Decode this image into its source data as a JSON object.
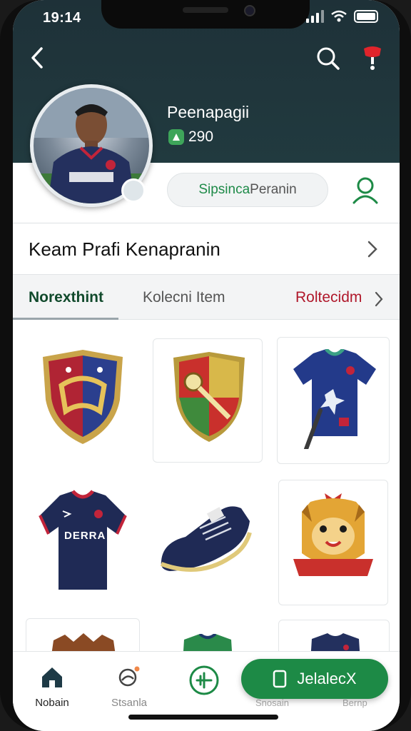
{
  "status_bar": {
    "time": "19:14"
  },
  "profile": {
    "name": "Peenapagii",
    "points": "290",
    "follow_button": {
      "green_part": "Sipsinca",
      "gray_part": " Peranin"
    }
  },
  "team_row": {
    "label": "Keam Prafi Kenapranin"
  },
  "tabs": [
    {
      "label": "Norexthint",
      "active": true
    },
    {
      "label": "Kolecni Item",
      "active": false
    },
    {
      "label": "Roltecidm",
      "active": false
    }
  ],
  "items": [
    {
      "name": "crest-harp",
      "icon": "crest-icon"
    },
    {
      "name": "crest-key",
      "icon": "crest-icon"
    },
    {
      "name": "away-jersey-bat",
      "icon": "jersey-icon"
    },
    {
      "name": "home-jersey",
      "icon": "jersey-icon",
      "text": "DERRA"
    },
    {
      "name": "navy-boot",
      "icon": "boot-icon"
    },
    {
      "name": "tiger-crest",
      "icon": "crest-icon"
    },
    {
      "name": "brown-item",
      "icon": "item-icon"
    },
    {
      "name": "green-jersey",
      "icon": "jersey-icon"
    },
    {
      "name": "navy-jersey",
      "icon": "jersey-icon"
    }
  ],
  "bottom_nav": {
    "home_label": "Nobain",
    "search_label": "Stsanla",
    "ghost_label_1": "Snosain",
    "ghost_label_2": "Bernp",
    "cta_label": "JelalecX"
  },
  "colors": {
    "header": "#1e3138",
    "accent_green": "#1d8a46",
    "accent_red": "#b0182b",
    "navy": "#23305e"
  }
}
